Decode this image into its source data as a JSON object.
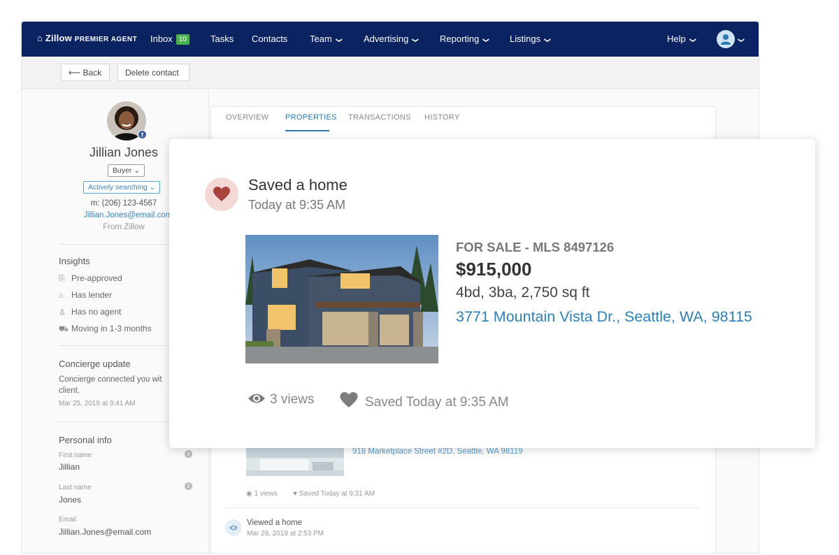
{
  "nav": {
    "logo": "Zillow",
    "logo_suffix": "PREMIER AGENT",
    "inbox": "Inbox",
    "inbox_count": "10",
    "tasks": "Tasks",
    "contacts": "Contacts",
    "team": "Team",
    "advertising": "Advertising",
    "reporting": "Reporting",
    "listings": "Listings",
    "help": "Help"
  },
  "toolbar": {
    "back": "Back",
    "delete": "Delete contact"
  },
  "contact": {
    "name": "Jillian Jones",
    "type": "Buyer",
    "status": "Actively searching",
    "phone": "m: (206) 123-4567",
    "email": "Jillian.Jones@email.com",
    "source": "From Zillow"
  },
  "insights": {
    "title": "Insights",
    "items": [
      "Pre-approved",
      "Has lender",
      "Has no agent",
      "Moving in 1-3 months"
    ]
  },
  "concierge": {
    "title": "Concierge update",
    "line1": "Concierge connected you wit",
    "line2": "client.",
    "date": "Mar 25, 2019 at 9:41 AM"
  },
  "personal": {
    "title": "Personal info",
    "first_label": "First name",
    "first": "Jillian",
    "last_label": "Last name",
    "last": "Jones",
    "email_label": "Email",
    "email": "Jillian.Jones@email.com"
  },
  "tabs": [
    "OVERVIEW",
    "PROPERTIES",
    "TRANSACTIONS",
    "HISTORY"
  ],
  "card": {
    "title": "Saved a home",
    "time": "Today at 9:35 AM",
    "listing_status": "FOR SALE - MLS 8497126",
    "price": "$915,000",
    "details": "4bd, 3ba, 2,750 sq ft",
    "address": "3771 Mountain Vista Dr., Seattle, WA, 98115",
    "views": "3 views",
    "saved": "Saved Today at 9:35 AM"
  },
  "second": {
    "address": "918 Marketplace Street #2D, Seattle, WA 98119",
    "views": "1 views",
    "saved": "Saved Today at 9:31 AM"
  },
  "viewed": {
    "title": "Viewed a home",
    "date": "Mar 29, 2019 at 2:53 PM"
  },
  "colors": {
    "nav": "#0b2461",
    "link": "#2f7fb5",
    "badge": "#4caf50",
    "heart": "#a8433d"
  }
}
